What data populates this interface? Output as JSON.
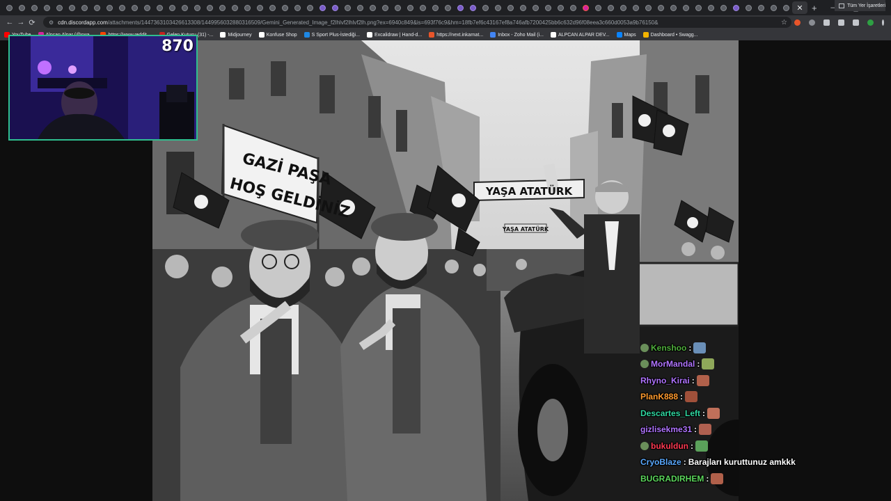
{
  "browser": {
    "url_host": "cdn.discordapp.com",
    "url_path": "/attachments/1447363103426613308/1449956032880316509/Gemini_Generated_Image_f2lhlvf2lhlvf2lh.png?ex=6940c849&is=693f76c9&hm=18fb7ef6c43167ef8a746afb7200425bb6c632d96f08eea3c660d0053a9b76150&",
    "bookmarks": [
      "YouTube",
      "Alpcan Alpar (@swa...",
      "https://www.reddit....",
      "Gelen Kutusu (31) -...",
      "Midjourney",
      "Konfuse Shop",
      "S Sport Plus-İstediği...",
      "Excalidraw | Hand-d...",
      "https://next.inkarnat...",
      "Inbox - Zoho Mail (i...",
      "ALPCAN ALPAR DEV...",
      "Maps",
      "Dashboard • Swagg..."
    ],
    "bookmarks_right": "Tüm Yer İşaretleri",
    "colors": {
      "tabstrip": "#1f2023",
      "toolbar": "#35363a",
      "omnibox": "#202124"
    }
  },
  "image": {
    "banner_left_line1": "GAZİ PAŞA",
    "banner_left_line2": "HOŞ GELDİNİZ",
    "banner_center": "YAŞA ATATÜRK",
    "banner_small": "YAŞA ATATÜRK"
  },
  "stream": {
    "viewer_count": "870",
    "border_color": "#2fbf8f"
  },
  "chat": {
    "messages": [
      {
        "name": "Kenshoo",
        "color": "#4fae3c",
        "message": ""
      },
      {
        "name": "MorMandal",
        "color": "#b074ff",
        "message": ""
      },
      {
        "name": "Rhyno_Kirai",
        "color": "#b074ff",
        "message": ""
      },
      {
        "name": "PlanK888",
        "color": "#ff9a2e",
        "message": ""
      },
      {
        "name": "Descartes_Left",
        "color": "#2fd6a0",
        "message": ""
      },
      {
        "name": "gizlisekme31",
        "color": "#b074ff",
        "message": ""
      },
      {
        "name": "bukuldun",
        "color": "#ff3a52",
        "message": ""
      },
      {
        "name": "CryoBlaze",
        "color": "#5aa9ff",
        "message": "Barajları kuruttunuz amkkk"
      },
      {
        "name": "BUGRADIRHEM",
        "color": "#5cd65c",
        "message": ""
      }
    ]
  }
}
